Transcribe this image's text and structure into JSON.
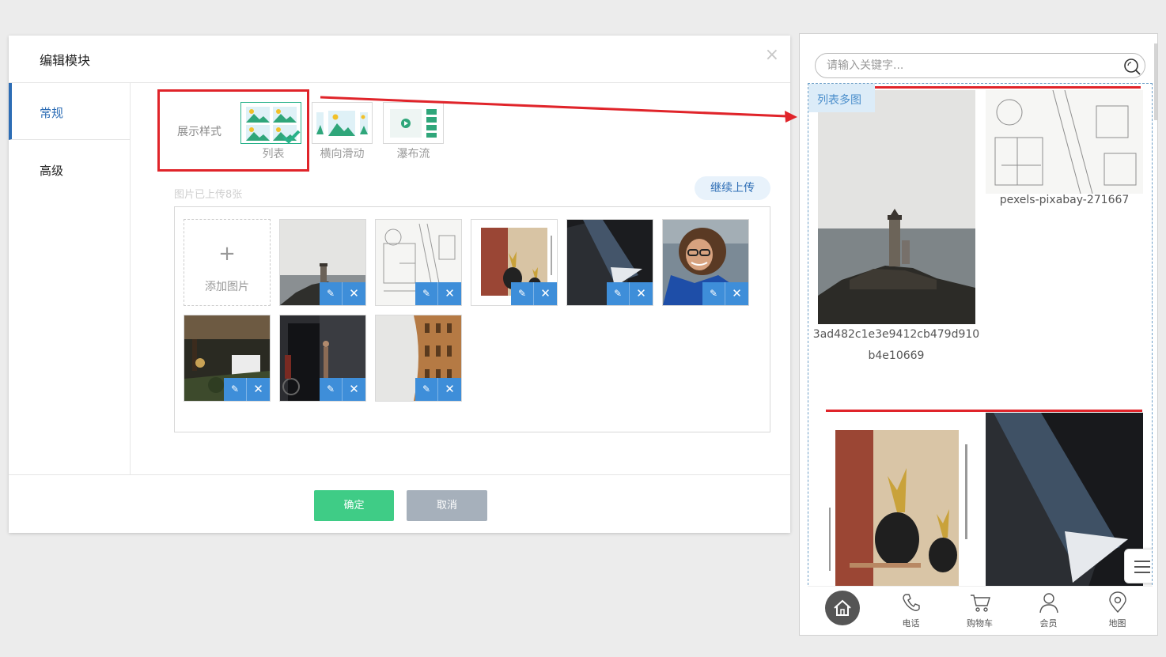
{
  "dialog": {
    "title": "编辑模块",
    "close": "×",
    "side_tabs": [
      {
        "label": "常规"
      },
      {
        "label": "高级"
      }
    ],
    "style_label": "展示样式",
    "style_options": [
      {
        "label": "列表",
        "selected": true
      },
      {
        "label": "横向滑动",
        "selected": false
      },
      {
        "label": "瀑布流",
        "selected": false
      }
    ],
    "uploaded_text": "图片已上传8张",
    "continue_upload": "继续上传",
    "add_image": "添加图片",
    "add_plus": "+",
    "images": [
      {
        "name": "lighthouse"
      },
      {
        "name": "blueprint"
      },
      {
        "name": "pineapple"
      },
      {
        "name": "architecture"
      },
      {
        "name": "woman"
      },
      {
        "name": "cafe"
      },
      {
        "name": "doorway"
      },
      {
        "name": "colosseum"
      }
    ],
    "tile_edit_icon": "✎",
    "tile_delete_icon": "✕",
    "ok": "确定",
    "cancel": "取消"
  },
  "preview": {
    "search_placeholder": "请输入关键字...",
    "module_tag": "列表多图",
    "items": [
      {
        "caption_line1": "3ad482c1e3e9412cb479d910",
        "caption_line2": "b4e10669"
      },
      {
        "caption_line1": "pexels-pixabay-271667"
      }
    ],
    "tabs": [
      {
        "label": "",
        "icon": "home-icon"
      },
      {
        "label": "电话",
        "icon": "phone-icon"
      },
      {
        "label": "购物车",
        "icon": "cart-icon"
      },
      {
        "label": "会员",
        "icon": "user-icon"
      },
      {
        "label": "地图",
        "icon": "map-pin-icon"
      }
    ]
  },
  "colors": {
    "accent_blue": "#2d6db5",
    "ok_green": "#3fcc86",
    "cancel_gray": "#a6b0bb",
    "highlight_red": "#e0242a",
    "tile_button_blue": "#3e8ed9"
  }
}
